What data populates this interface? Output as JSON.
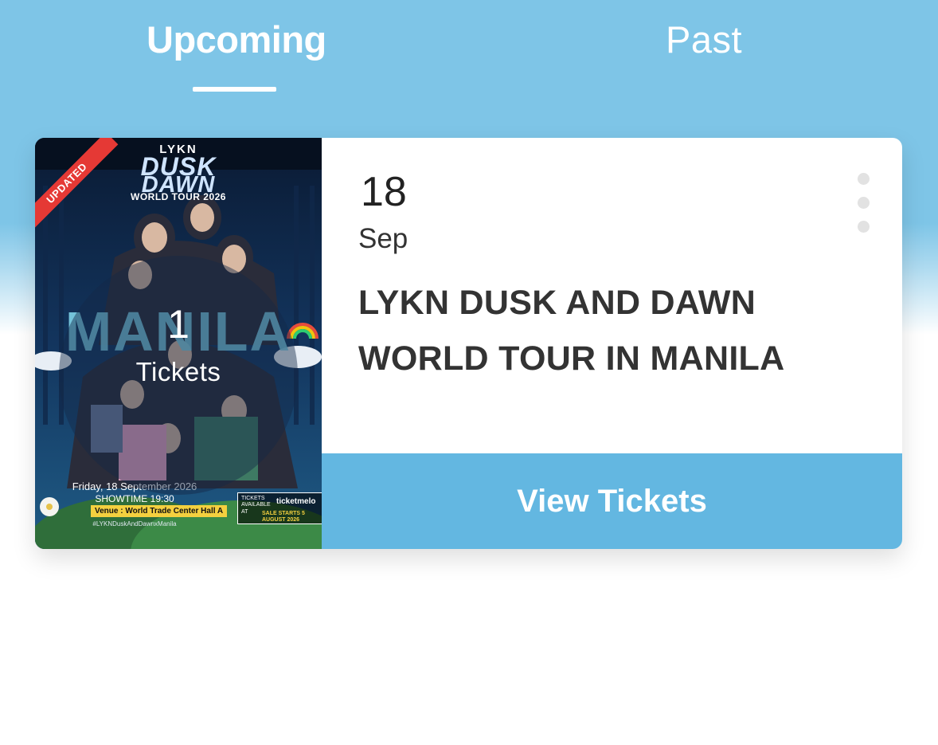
{
  "tabs": {
    "upcoming": "Upcoming",
    "past": "Past",
    "active": "upcoming"
  },
  "event": {
    "day": "18",
    "month": "Sep",
    "title": "LYKN DUSK AND DAWN WORLD TOUR IN MANILA",
    "ticket_count": "1",
    "ticket_label": "Tickets",
    "button_label": "View Tickets",
    "more_icon": "more-vertical-icon"
  },
  "poster": {
    "ribbon": "UPDATED",
    "brand": "LYKN",
    "dusk": "DUSK",
    "dawn": "DAWN",
    "tour": "WORLD TOUR 2026",
    "city": "MANILA",
    "date": "Friday, 18 September 2026",
    "showtime": "SHOWTIME 19:30",
    "venue": "Venue : World Trade Center Hall A",
    "hashtag": "#LYKNDuskAndDawnxManila",
    "tickets_available": "TICKETS AVAILABLE AT",
    "vendor": "ticketmelo",
    "sale": "SALE STARTS 5 AUGUST 2026"
  },
  "colors": {
    "header_bg": "#7ec5e7",
    "button_bg": "#63b7e1",
    "ribbon": "#e53935"
  }
}
